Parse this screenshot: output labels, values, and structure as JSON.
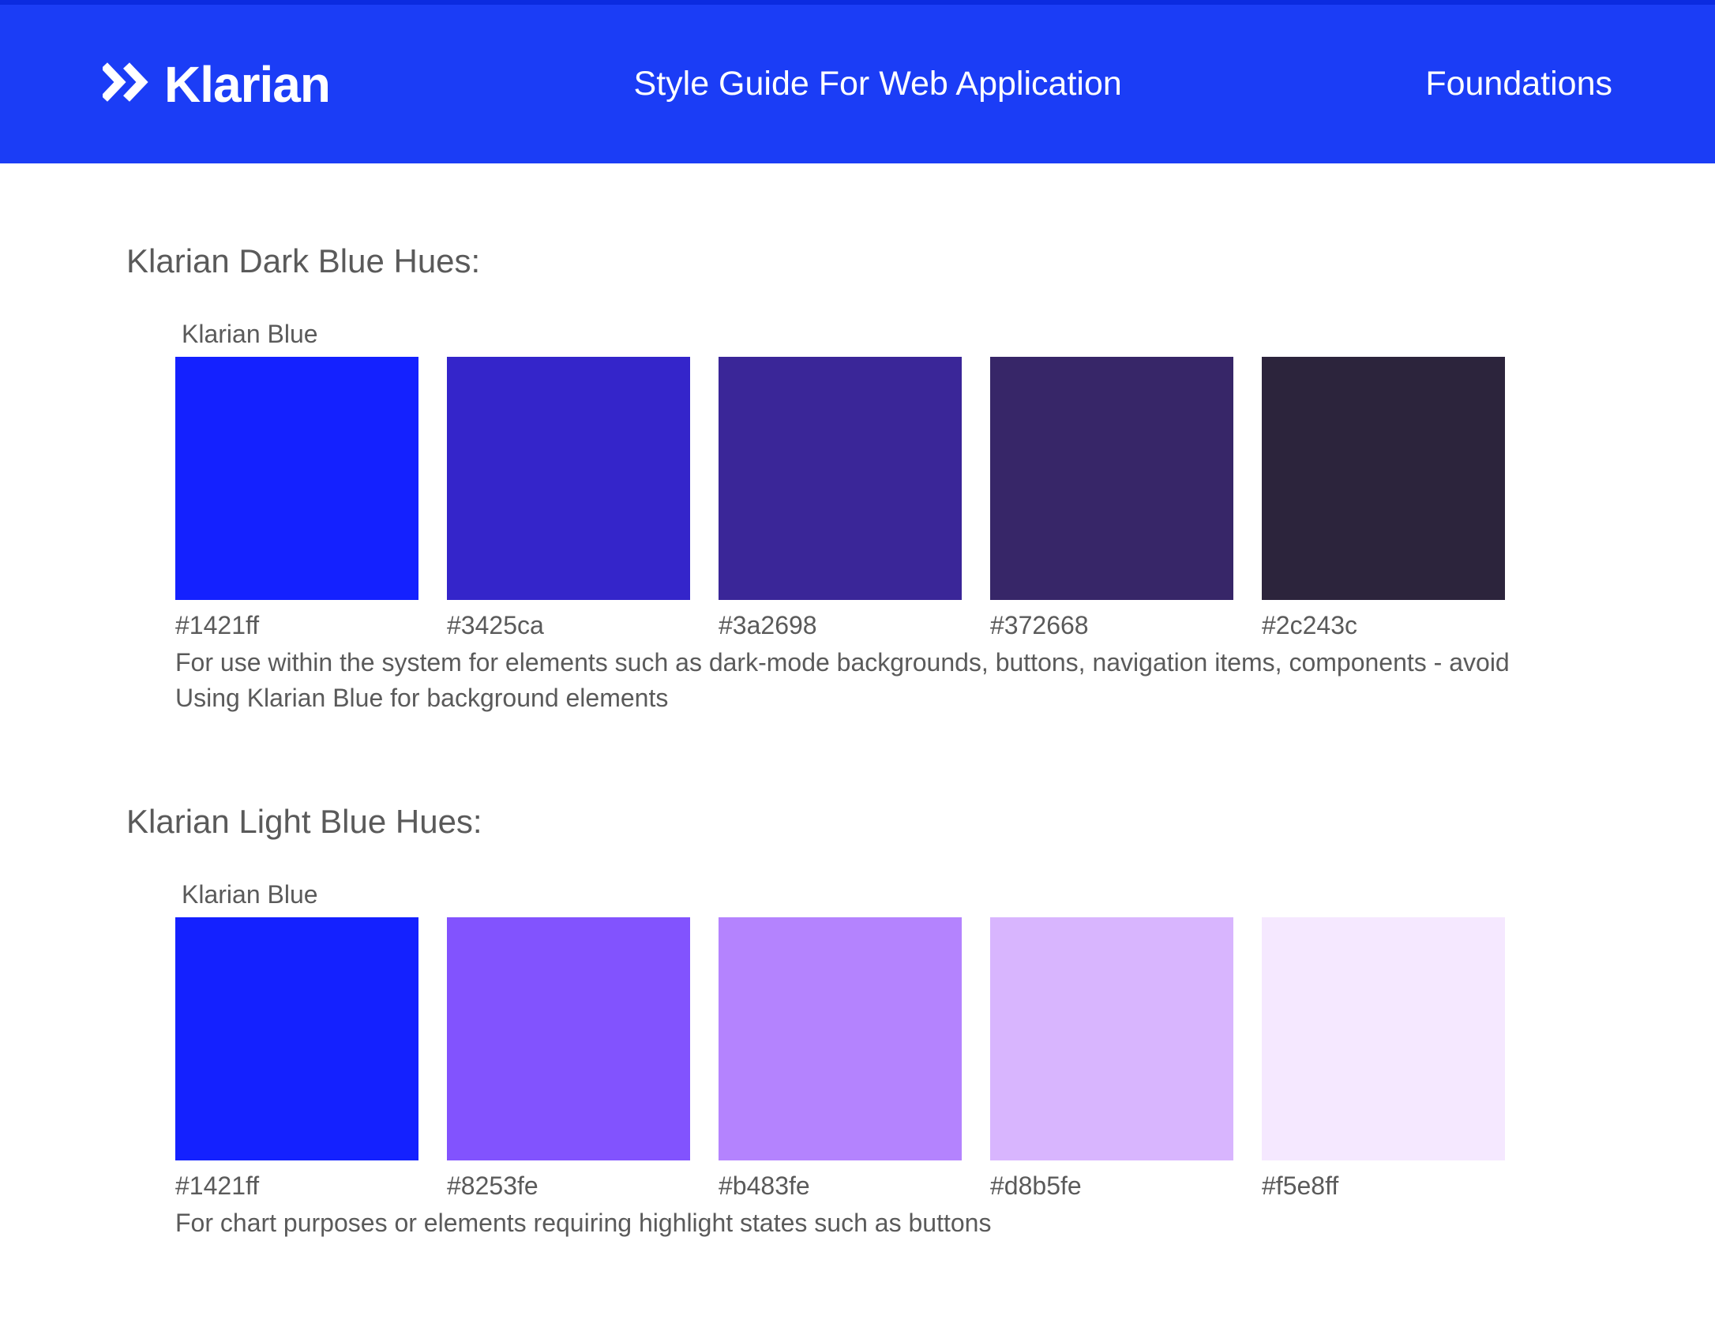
{
  "header": {
    "brand": "Klarian",
    "title": "Style Guide For Web Application",
    "section": "Foundations",
    "bg_color": "#1b3df6"
  },
  "dark_hues": {
    "heading": "Klarian Dark Blue Hues:",
    "primary_label": "Klarian Blue",
    "swatches": [
      {
        "hex": "#1421ff",
        "color": "#1421ff"
      },
      {
        "hex": "#3425ca",
        "color": "#3425ca"
      },
      {
        "hex": "#3a2698",
        "color": "#3a2698"
      },
      {
        "hex": "#372668",
        "color": "#372668"
      },
      {
        "hex": "#2c243c",
        "color": "#2c243c"
      }
    ],
    "description": "For use within the system for elements such as dark-mode backgrounds, buttons, navigation items, components - avoid Using Klarian Blue for background elements"
  },
  "light_hues": {
    "heading": "Klarian Light Blue Hues:",
    "primary_label": "Klarian Blue",
    "swatches": [
      {
        "hex": "#1421ff",
        "color": "#1421ff"
      },
      {
        "hex": "#8253fe",
        "color": "#8253fe"
      },
      {
        "hex": "#b483fe",
        "color": "#b483fe"
      },
      {
        "hex": "#d8b5fe",
        "color": "#d8b5fe"
      },
      {
        "hex": "#f5e8ff",
        "color": "#f5e8ff"
      }
    ],
    "description": "For chart purposes or elements requiring highlight states such as buttons"
  }
}
